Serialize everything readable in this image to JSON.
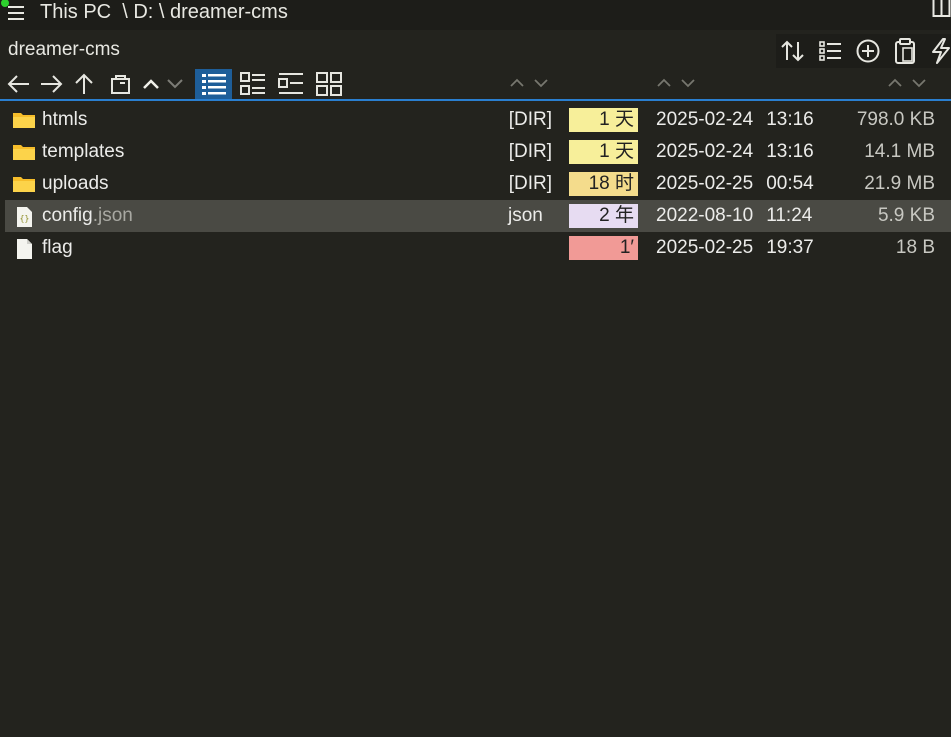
{
  "path_bar": {
    "text": "This PC  \\ D: \\ dreamer-cms"
  },
  "folder_title": "dreamer-cms",
  "toolbar_right": [
    "sort-icon",
    "list-settings-icon",
    "add-circle-icon",
    "clipboard-icon",
    "lightning-icon"
  ],
  "nav_icons": [
    "back-arrow-icon",
    "forward-arrow-icon",
    "up-arrow-icon",
    "new-window-icon",
    "chevron-up-icon",
    "chevron-down-icon"
  ],
  "view_modes": [
    "details-view-icon",
    "tiles-view-icon",
    "list-view-icon",
    "grid-view-icon"
  ],
  "files": [
    {
      "name": "htmls",
      "ext": "",
      "type": "[DIR]",
      "age": "1 天",
      "age_color": "#f7ef9a",
      "date": "2025-02-24",
      "time": "13:16",
      "size": "798.0 KB",
      "icon": "folder-icon"
    },
    {
      "name": "templates",
      "ext": "",
      "type": "[DIR]",
      "age": "1 天",
      "age_color": "#f7ef9a",
      "date": "2025-02-24",
      "time": "13:16",
      "size": "14.1 MB",
      "icon": "folder-icon"
    },
    {
      "name": "uploads",
      "ext": "",
      "type": "[DIR]",
      "age": "18 时",
      "age_color": "#f4dc8c",
      "date": "2025-02-25",
      "time": "00:54",
      "size": "21.9 MB",
      "icon": "folder-icon"
    },
    {
      "name": "config",
      "ext": ".json",
      "type": "json",
      "age": "2 年",
      "age_color": "#e7dcf2",
      "date": "2022-08-10",
      "time": "11:24",
      "size": "5.9 KB",
      "icon": "json-file-icon",
      "selected": true
    },
    {
      "name": "flag",
      "ext": "",
      "type": "",
      "age": "1′",
      "age_color": "#f19a96",
      "date": "2025-02-25",
      "time": "19:37",
      "size": "18 B",
      "icon": "file-icon"
    }
  ],
  "colors": {
    "background": "#23231e",
    "accent": "#2a7fd0",
    "folder": "#f6bd2a",
    "selected_row": "#4a4a44"
  }
}
